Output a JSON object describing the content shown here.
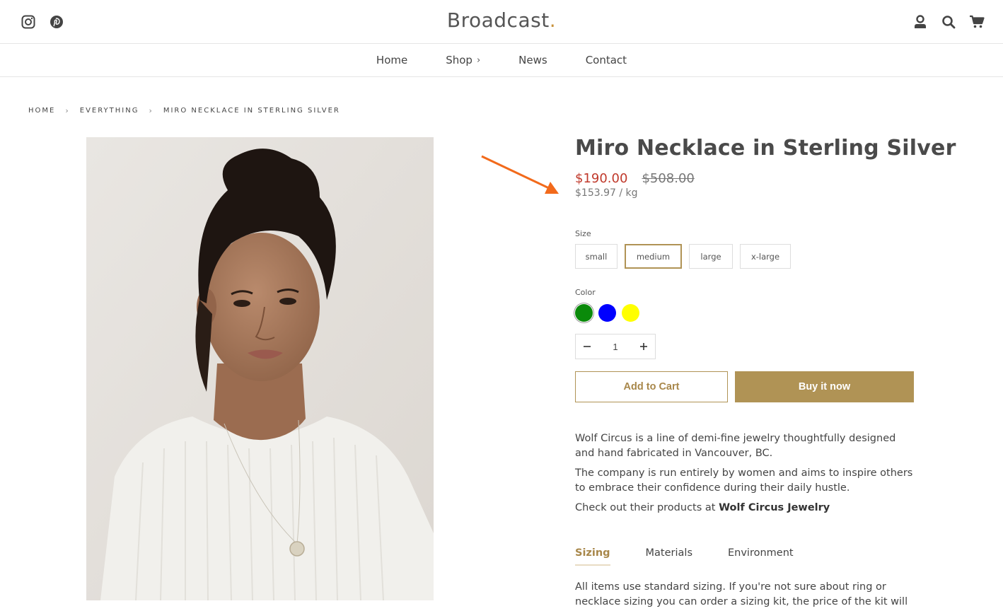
{
  "header": {
    "logo_text": "Broadcast",
    "logo_dot": ".",
    "social_icons": [
      "instagram-icon",
      "pinterest-icon"
    ],
    "right_icons": [
      "account-icon",
      "search-icon",
      "cart-icon"
    ]
  },
  "nav": {
    "items": [
      {
        "label": "Home"
      },
      {
        "label": "Shop",
        "chevron": "›"
      },
      {
        "label": "News"
      },
      {
        "label": "Contact"
      }
    ]
  },
  "breadcrumb": {
    "items": [
      "Home",
      "Everything",
      "Miro Necklace in Sterling Silver"
    ],
    "separator": "›"
  },
  "product": {
    "title": "Miro Necklace in Sterling Silver",
    "price": "$190.00",
    "compare_price": "$508.00",
    "unit_price": "$153.97 / kg",
    "size_label": "Size",
    "sizes": [
      "small",
      "medium",
      "large",
      "x-large"
    ],
    "selected_size": "medium",
    "color_label": "Color",
    "colors": [
      "#0a8a0a",
      "#0000ff",
      "#ffff00"
    ],
    "selected_color": "#0a8a0a",
    "quantity": "1",
    "add_to_cart": "Add to Cart",
    "buy_now": "Buy it now",
    "description": [
      "Wolf Circus is a line of demi-fine jewelry thoughtfully designed and hand fabricated in Vancouver, BC.",
      "The company is run entirely by women and aims to inspire others to embrace their confidence during their daily hustle."
    ],
    "description_link_prefix": "Check out their products at ",
    "description_link": "Wolf Circus Jewelry",
    "tabs": [
      "Sizing",
      "Materials",
      "Environment"
    ],
    "active_tab": "Sizing",
    "tab_content": "All items use standard sizing.  If you're not sure about ring or necklace sizing you can order a sizing kit, the price of the kit will"
  },
  "colors": {
    "accent": "#b09355",
    "sale": "#c0392b",
    "annotation_arrow": "#f26a1b"
  }
}
